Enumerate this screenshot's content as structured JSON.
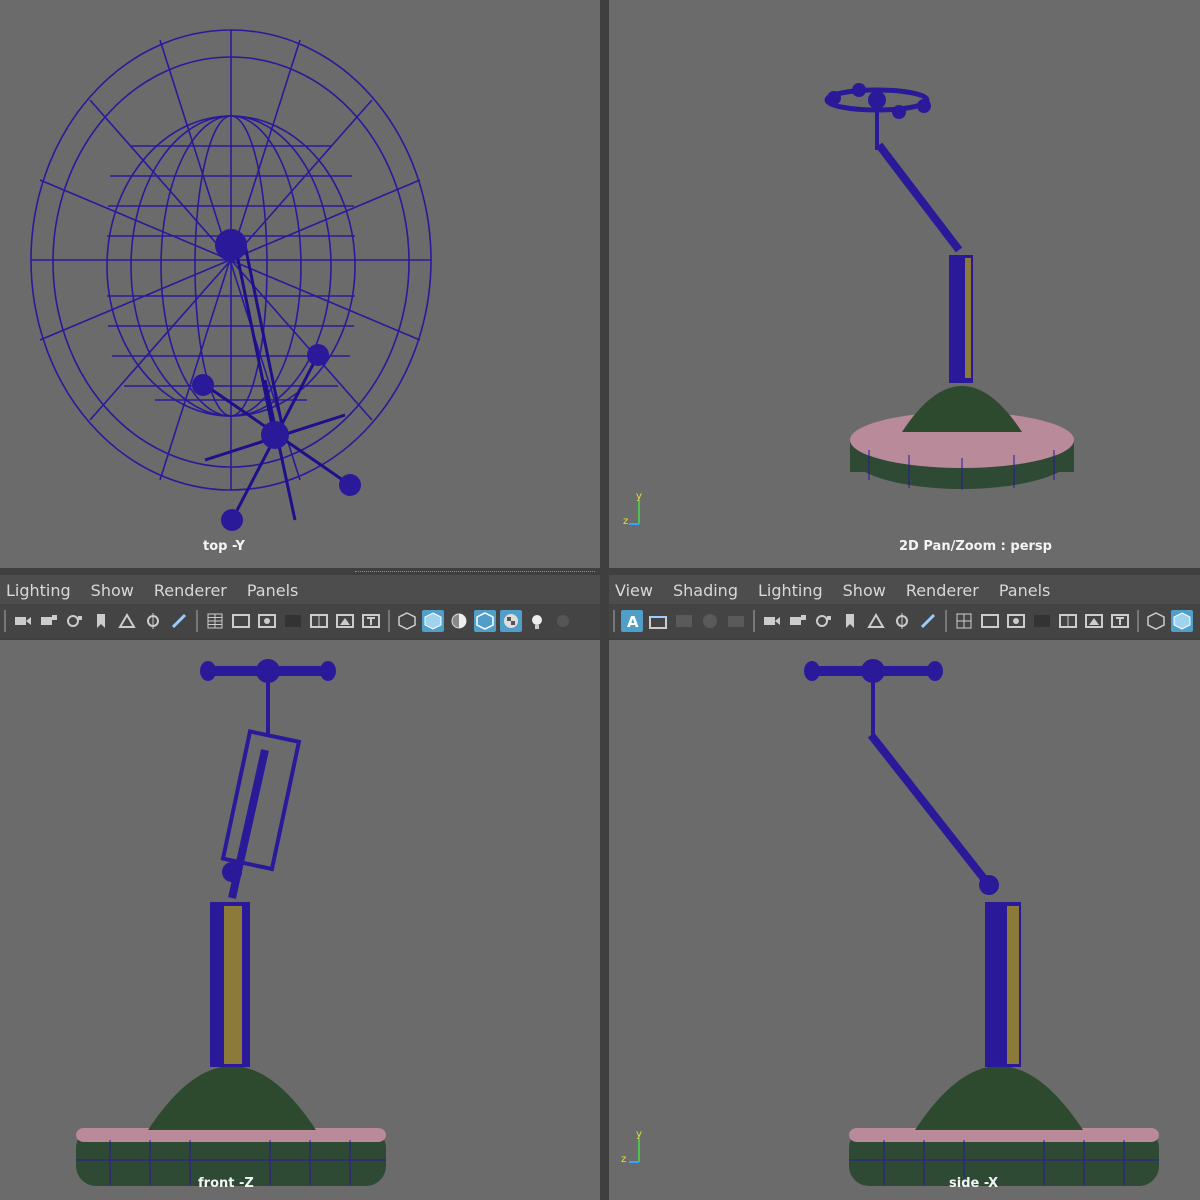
{
  "viewports": {
    "top_left": {
      "label": "top -Y"
    },
    "top_right": {
      "label": "2D Pan/Zoom : persp"
    },
    "bottom_left": {
      "label": "front -Z"
    },
    "bottom_right": {
      "label": "side -X"
    }
  },
  "left_panel": {
    "menu": [
      "Lighting",
      "Show",
      "Renderer",
      "Panels"
    ]
  },
  "right_panel": {
    "menu": [
      "View",
      "Shading",
      "Lighting",
      "Show",
      "Renderer",
      "Panels"
    ]
  },
  "axis_labels": {
    "y": "y",
    "z": "z"
  },
  "colors": {
    "viewport_bg": "#6b6b6b",
    "wire": "#2a1a9a",
    "toolbar_bg": "#444444",
    "menubar_bg": "#4d4d4d",
    "selected_icon": "#4f9fc9",
    "base_pink": "#b88a9a",
    "pole_gold": "#8c7a3a",
    "dome_green": "#2e5a2e"
  },
  "icons": [
    "camera-icon",
    "camera-lock-icon",
    "camera-attr-icon",
    "bookmark-icon",
    "image-plane-icon",
    "pivot-icon",
    "paint-icon",
    "grid-icon",
    "film-gate-icon",
    "resolution-gate-icon",
    "gate-mask-icon",
    "field-chart-icon",
    "safe-action-icon",
    "safe-title-icon",
    "wireframe-icon",
    "smooth-shade-icon",
    "default-light-icon",
    "shade-selected-icon",
    "textured-icon",
    "lights-icon",
    "shadows-icon"
  ]
}
